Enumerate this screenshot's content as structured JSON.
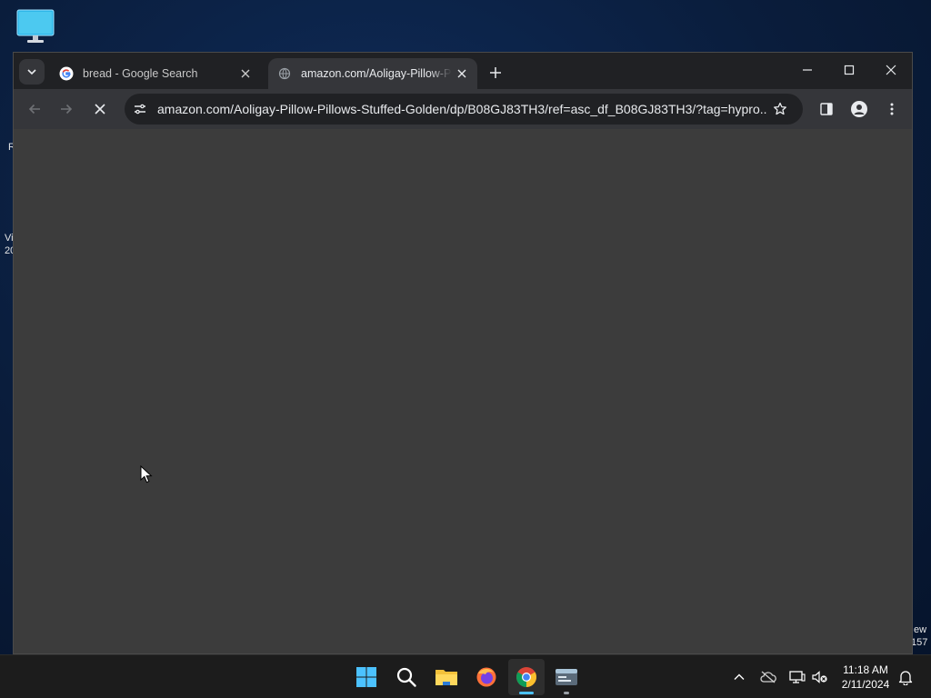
{
  "desktop": {
    "edge_texts": [
      {
        "text": "R"
      },
      {
        "text": "Vi"
      },
      {
        "text": "20"
      },
      {
        "text": "ew"
      },
      {
        "text": "157"
      }
    ]
  },
  "browser": {
    "tabs": [
      {
        "title": "bread - Google Search",
        "favicon": "google-g-icon",
        "active": false
      },
      {
        "title": "amazon.com/Aoligay-Pillow-Pillows-Stuffed-Golden",
        "favicon": "loading-globe-icon",
        "active": true
      }
    ],
    "address_bar": {
      "url": "amazon.com/Aoligay-Pillow-Pillows-Stuffed-Golden/dp/B08GJ83TH3/ref=asc_df_B08GJ83TH3/?tag=hypro..."
    },
    "loading": true
  },
  "taskbar": {
    "apps": [
      {
        "name": "start",
        "icon": "windows-logo-icon"
      },
      {
        "name": "search",
        "icon": "search-icon"
      },
      {
        "name": "file-explorer",
        "icon": "folder-icon"
      },
      {
        "name": "firefox",
        "icon": "firefox-icon"
      },
      {
        "name": "chrome",
        "icon": "chrome-icon",
        "active": true
      },
      {
        "name": "terminal",
        "icon": "terminal-icon"
      }
    ],
    "clock": {
      "time": "11:18 AM",
      "date": "2/11/2024"
    }
  },
  "colors": {
    "accent": "#4cc2ff",
    "tab_bar": "#202124",
    "toolbar": "#35363a",
    "content": "#3c3c3c"
  }
}
